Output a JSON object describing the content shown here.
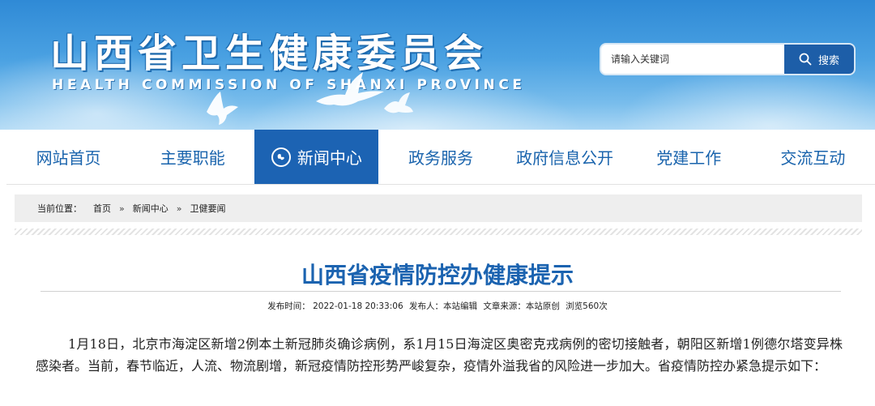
{
  "header": {
    "title": "山西省卫生健康委员会",
    "subtitle": "HEALTH COMMISSION OF SHANXI PROVINCE"
  },
  "search": {
    "placeholder": "请输入关键词",
    "button_label": "搜索"
  },
  "nav": {
    "items": [
      {
        "label": "网站首页"
      },
      {
        "label": "主要职能"
      },
      {
        "label": "新闻中心"
      },
      {
        "label": "政务服务"
      },
      {
        "label": "政府信息公开"
      },
      {
        "label": "党建工作"
      },
      {
        "label": "交流互动"
      }
    ],
    "active_index": 2
  },
  "breadcrumb": {
    "label": "当前位置：",
    "items": [
      "首页",
      "新闻中心",
      "卫健要闻"
    ],
    "separator": "»"
  },
  "article": {
    "title": "山西省疫情防控办健康提示",
    "meta": {
      "publish_time": "发布时间： 2022-01-18 20:33:06",
      "publisher": "发布人：本站编辑",
      "source": "文章来源：本站原创",
      "views": "浏览560次"
    },
    "body": "1月18日，北京市海淀区新增2例本土新冠肺炎确诊病例，系1月15日海淀区奥密克戎病例的密切接触者，朝阳区新增1例德尔塔变异株感染者。当前，春节临近，人流、物流剧增，新冠疫情防控形势严峻复杂，疫情外溢我省的风险进一步加大。省疫情防控办紧急提示如下："
  },
  "colors": {
    "brand_blue": "#1c63b3",
    "nav_text": "#1a64ad",
    "title_blue": "#1b63b0"
  }
}
